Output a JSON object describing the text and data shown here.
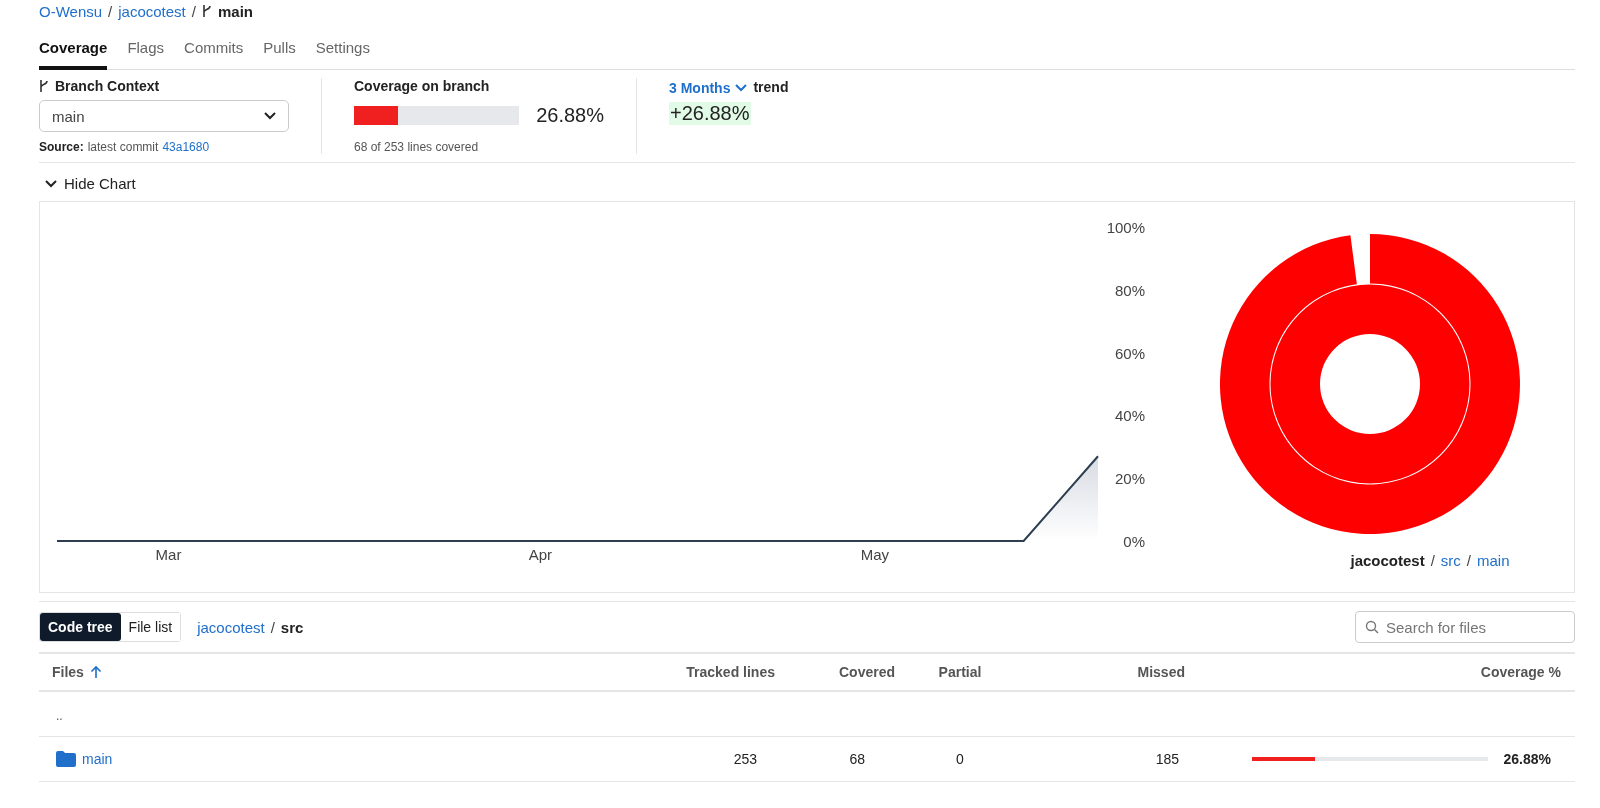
{
  "breadcrumb": {
    "parts": [
      {
        "text": "O-Wensu"
      },
      {
        "separator": "/",
        "text": "jacocotest"
      }
    ],
    "branch": {
      "separator": "/",
      "text": "main"
    }
  },
  "tabs": [
    {
      "label": "Coverage",
      "selected": true
    },
    {
      "label": "Flags",
      "selected": false
    },
    {
      "label": "Commits",
      "selected": false
    },
    {
      "label": "Pulls",
      "selected": false
    },
    {
      "label": "Settings",
      "selected": false
    }
  ],
  "branch_context": {
    "title": "Branch Context",
    "value": "main",
    "source_label": "Source:",
    "source_text": "latest commit",
    "commit": "43a1680"
  },
  "coverage": {
    "title": "Coverage on branch",
    "level": 0.2688,
    "percent": "26.88%",
    "lines": "68 of 253 lines covered"
  },
  "trend": {
    "period": "3 Months",
    "label": "trend",
    "change": "+26.88%"
  },
  "chart_toggle": {
    "label": "Hide Chart",
    "expanded": true
  },
  "chart": {
    "chart_data": {
      "type": "area",
      "categories": [
        null,
        null,
        null,
        "Mar",
        null,
        null,
        null,
        null,
        null,
        null,
        null,
        null,
        null,
        "Apr",
        null,
        null,
        null,
        null,
        null,
        null,
        null,
        null,
        "May",
        null,
        null,
        null,
        null,
        null,
        null
      ],
      "series": [
        {
          "color": "#2c3e50",
          "values": [
            0,
            0,
            0,
            0,
            0,
            0,
            0,
            0,
            0,
            0,
            0,
            0,
            0,
            0,
            0,
            0,
            0,
            0,
            0,
            0,
            0,
            0,
            0,
            0,
            0,
            0,
            0,
            13.5,
            27
          ]
        }
      ],
      "ylim": [
        0,
        100
      ],
      "yticks": [
        {
          "value": 0,
          "label": "0%"
        },
        {
          "value": 20,
          "label": "20%"
        },
        {
          "value": 40,
          "label": "40%"
        },
        {
          "value": 60,
          "label": "60%"
        },
        {
          "value": 80,
          "label": "80%"
        },
        {
          "value": 100,
          "label": "100%"
        }
      ]
    }
  },
  "sunburst": {
    "path": [
      {
        "text": "jacocotest",
        "current": true
      },
      {
        "separator": "/",
        "text": "src",
        "current": false
      },
      {
        "separator": "/",
        "text": "main",
        "current": false
      }
    ]
  },
  "view_toggle": [
    {
      "label": "Code tree",
      "selected": true
    },
    {
      "label": "File list",
      "selected": false
    }
  ],
  "path": [
    {
      "text": "jacocotest",
      "current": false
    },
    {
      "separator": "/",
      "text": "src",
      "current": true
    }
  ],
  "search": {
    "placeholder": "Search for files"
  },
  "table": {
    "columns": [
      {
        "label": "Files",
        "sorted": true
      },
      {
        "label": "Tracked lines",
        "sorted": false
      },
      {
        "label": "Covered",
        "sorted": false
      },
      {
        "label": "Partial",
        "sorted": false
      },
      {
        "label": "Missed",
        "sorted": false
      },
      {
        "label": "Coverage %",
        "sorted": false
      }
    ],
    "rows": [
      {
        "kind": "parent",
        "name": ".."
      },
      {
        "kind": "folder",
        "name": "main",
        "tracked": "253",
        "covered": "68",
        "partial": "0",
        "missed": "185",
        "level": 0.2688,
        "coverage": "26.88%"
      }
    ]
  }
}
